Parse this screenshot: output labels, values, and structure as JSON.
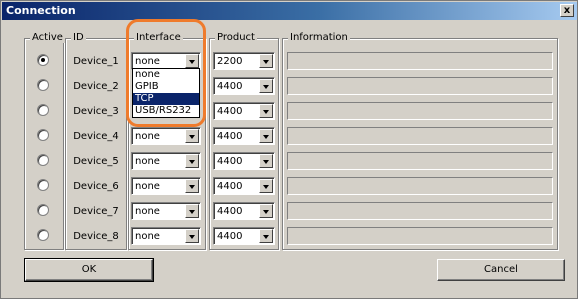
{
  "window": {
    "title": "Connection",
    "close_label": "x"
  },
  "groups": {
    "active": "Active",
    "id": "ID",
    "interface": "Interface",
    "product": "Product",
    "information": "Information"
  },
  "devices": [
    {
      "label": "Device_1",
      "active": true,
      "interface": "none",
      "product": "2200"
    },
    {
      "label": "Device_2",
      "active": false,
      "interface": "",
      "product": "4400"
    },
    {
      "label": "Device_3",
      "active": false,
      "interface": "",
      "product": "4400"
    },
    {
      "label": "Device_4",
      "active": false,
      "interface": "none",
      "product": "4400"
    },
    {
      "label": "Device_5",
      "active": false,
      "interface": "none",
      "product": "4400"
    },
    {
      "label": "Device_6",
      "active": false,
      "interface": "none",
      "product": "4400"
    },
    {
      "label": "Device_7",
      "active": false,
      "interface": "none",
      "product": "4400"
    },
    {
      "label": "Device_8",
      "active": false,
      "interface": "none",
      "product": "4400"
    }
  ],
  "interface_dropdown": {
    "options": [
      "none",
      "GPIB",
      "TCP",
      "USB/RS232"
    ],
    "highlighted": "TCP"
  },
  "buttons": {
    "ok": "OK",
    "cancel": "Cancel"
  },
  "colors": {
    "annotation_outline": "#ef7b2c",
    "selection": "#0a246a",
    "title_bar": "#0a246a"
  }
}
